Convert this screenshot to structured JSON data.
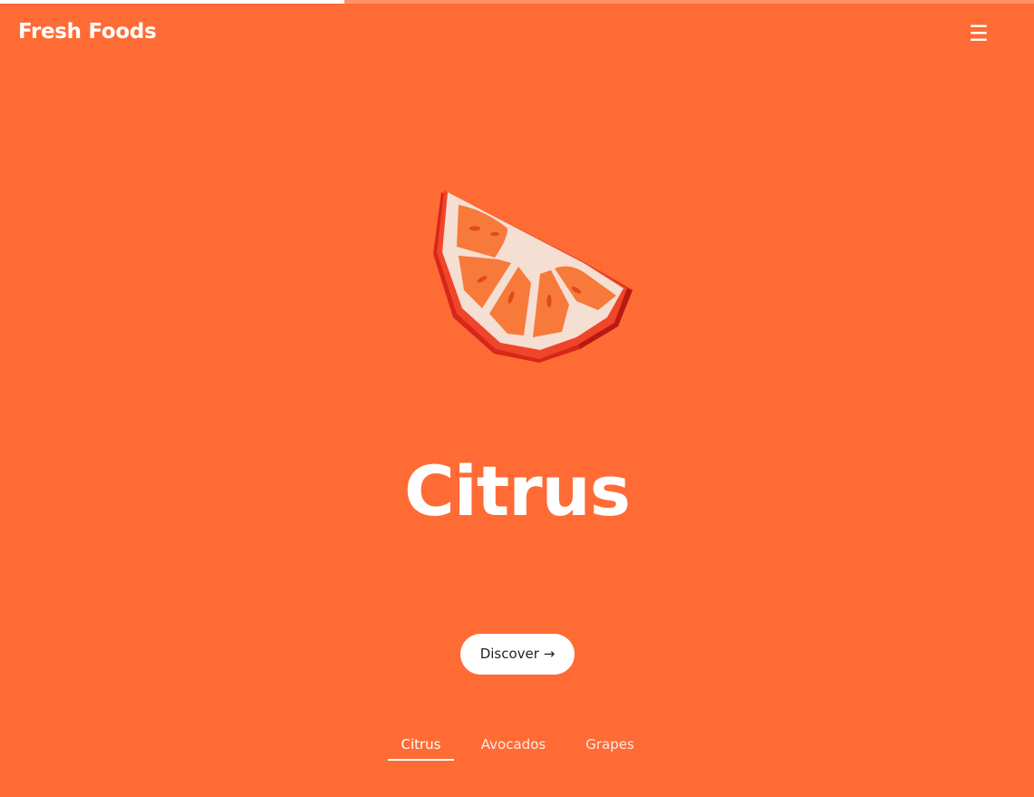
{
  "header": {
    "brand": "Fresh Foods",
    "menu_icon": "☰"
  },
  "slider": {
    "progress_fraction": 0.333
  },
  "hero": {
    "image_icon": "orange-slice-icon",
    "title": "Citrus",
    "cta_label": "Discover →"
  },
  "tabs": [
    {
      "label": "Citrus",
      "active": true
    },
    {
      "label": "Avocados",
      "active": false
    },
    {
      "label": "Grapes",
      "active": false
    }
  ],
  "colors": {
    "background": "#FF6B35",
    "text": "#FFFFFF",
    "button_bg": "#FFFFFF",
    "button_text": "#1F1F1F"
  }
}
